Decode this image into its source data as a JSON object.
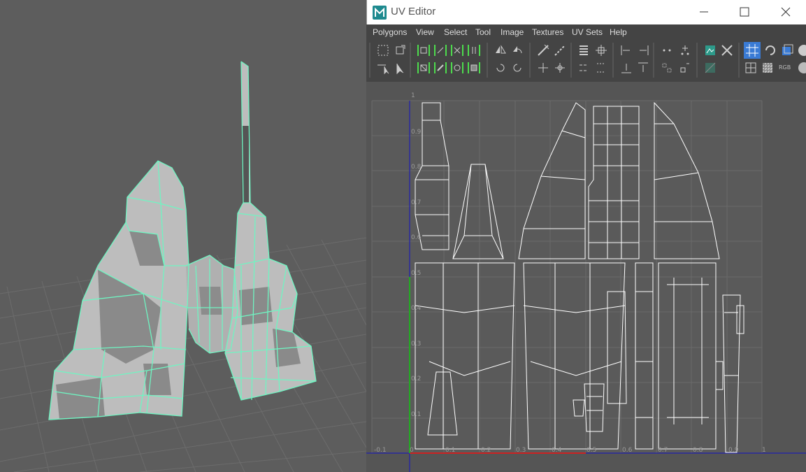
{
  "window": {
    "title": "UV Editor"
  },
  "menu": [
    "Polygons",
    "View",
    "Select",
    "Tool",
    "Image",
    "Textures",
    "UV Sets",
    "Help"
  ],
  "uv_axis": {
    "u_ticks": [
      "-0.1",
      "0",
      "0.1",
      "0.2",
      "0.3",
      "0.4",
      "0.5",
      "0.6",
      "0.7",
      "0.8",
      "0.9",
      "1"
    ],
    "v_ticks": [
      "1",
      "0.9",
      "0.8",
      "0.7",
      "0.6",
      "0.5",
      "0.4",
      "0.3",
      "0.2",
      "0.1"
    ]
  },
  "toolbar": {
    "rgb_label": "RGB"
  },
  "colors": {
    "wireframe": "#6ff5c2",
    "uv_shell": "#ffffff",
    "u_axis": "#cc2222",
    "v_axis": "#22aa22",
    "selection": "#3a7bd5"
  }
}
